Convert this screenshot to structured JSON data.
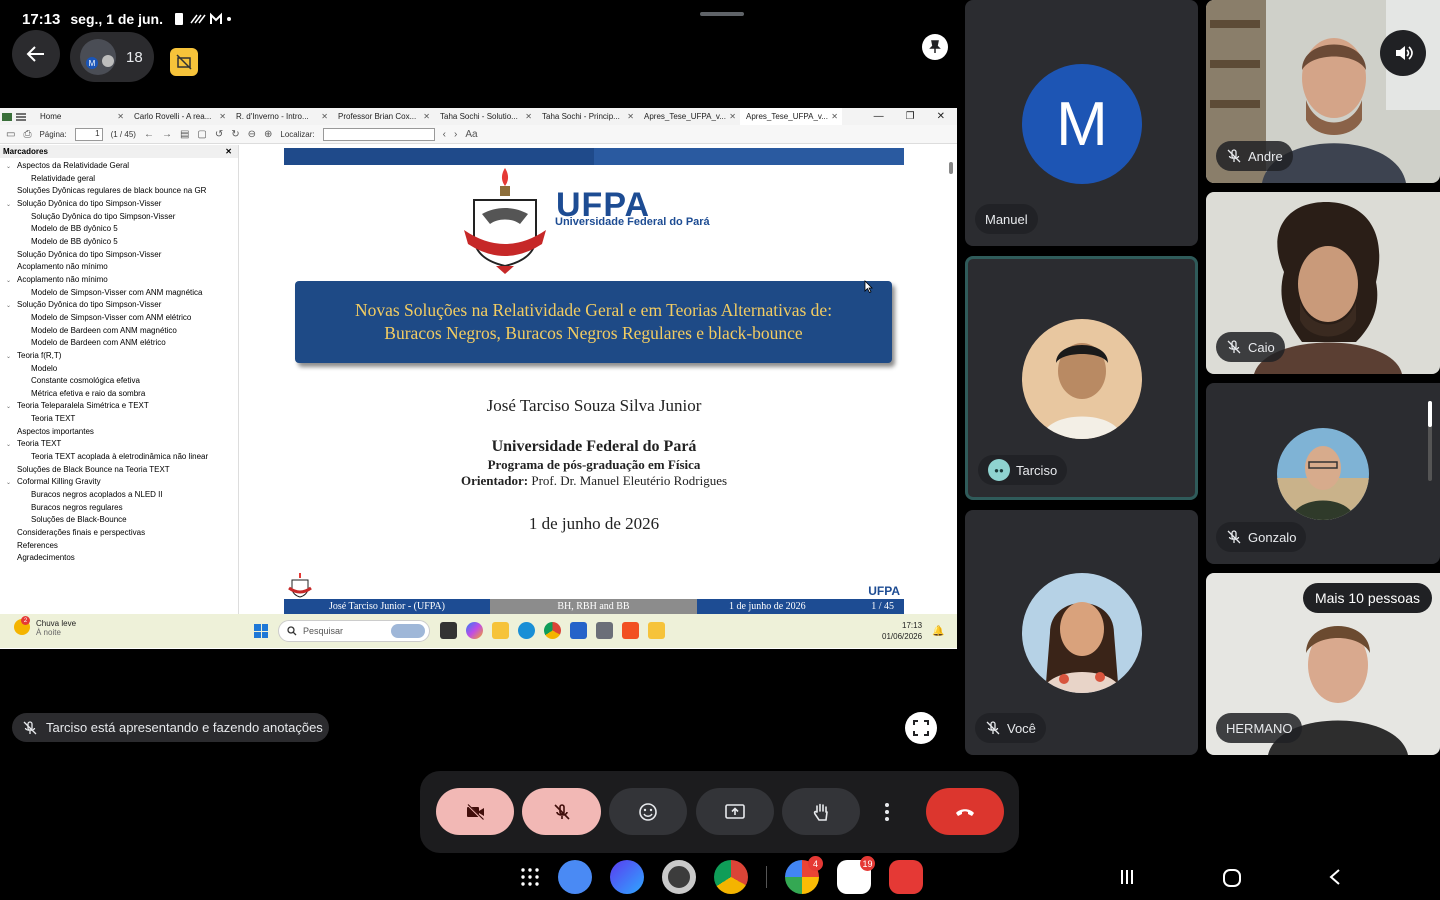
{
  "status_bar": {
    "time": "17:13",
    "date": "seg., 1 de jun."
  },
  "meeting": {
    "participant_count": "18"
  },
  "viewer": {
    "tabs": [
      "Home",
      "Carlo Rovelli - A rea...",
      "R. d'Inverno - Intro...",
      "Professor Brian Cox...",
      "Taha Sochi - Solutio...",
      "Taha Sochi - Princip...",
      "Apres_Tese_UFPA_v...",
      "Apres_Tese_UFPA_v..."
    ],
    "page_label": "Página:",
    "page_value": "1",
    "page_total": "(1 / 45)",
    "find_label": "Localizar:",
    "bookmarks_title": "Marcadores",
    "bookmarks": [
      {
        "label": "Aspectos da Relatividade Geral",
        "level": 0
      },
      {
        "label": "Relatividade geral",
        "level": 1
      },
      {
        "label": "Soluções Dyônicas regulares de black bounce na GR",
        "level": 0
      },
      {
        "label": "Solução Dyônica do tipo Simpson-Visser",
        "level": 0
      },
      {
        "label": "Solução Dyônica do tipo Simpson-Visser",
        "level": 1
      },
      {
        "label": "Modelo de BB dyônico 5",
        "level": 1
      },
      {
        "label": "Modelo de BB dyônico 5",
        "level": 1
      },
      {
        "label": "Solução Dyônica do tipo Simpson-Visser",
        "level": 0
      },
      {
        "label": "Acoplamento não mínimo",
        "level": 0
      },
      {
        "label": "Acoplamento não mínimo",
        "level": 0
      },
      {
        "label": "Modelo de Simpson-Visser com ANM magnética",
        "level": 1
      },
      {
        "label": "Solução Dyônica do tipo Simpson-Visser",
        "level": 0
      },
      {
        "label": "Modelo de Simpson-Visser com ANM elétrico",
        "level": 1
      },
      {
        "label": "Modelo de Bardeen com ANM magnético",
        "level": 1
      },
      {
        "label": "Modelo de Bardeen com ANM elétrico",
        "level": 1
      },
      {
        "label": "Teoria f(R,T)",
        "level": 0
      },
      {
        "label": "Modelo",
        "level": 1
      },
      {
        "label": "Constante cosmológica efetiva",
        "level": 1
      },
      {
        "label": "Métrica efetiva e raio da sombra",
        "level": 1
      },
      {
        "label": "Teoria Teleparalela Simétrica e TEXT",
        "level": 0
      },
      {
        "label": "Teoria TEXT",
        "level": 1
      },
      {
        "label": "Aspectos importantes",
        "level": 0
      },
      {
        "label": "Teoria TEXT",
        "level": 0
      },
      {
        "label": "Teoria TEXT acoplada à eletrodinâmica não linear",
        "level": 1
      },
      {
        "label": "Soluções de Black Bounce na Teoria TEXT",
        "level": 0
      },
      {
        "label": "Coformal Killing Gravity",
        "level": 0
      },
      {
        "label": "Buracos negros acoplados a NLED II",
        "level": 1
      },
      {
        "label": "Buracos negros regulares",
        "level": 1
      },
      {
        "label": "Soluções de Black-Bounce",
        "level": 1
      },
      {
        "label": "Considerações finais e perspectivas",
        "level": 0
      },
      {
        "label": "References",
        "level": 0
      },
      {
        "label": "Agradecimentos",
        "level": 0
      }
    ]
  },
  "slide": {
    "logo_text": "UFPA",
    "logo_subtitle": "Universidade Federal do Pará",
    "title_line1": "Novas Soluções na Relatividade Geral e em Teorias Alternativas de:",
    "title_line2": "Buracos Negros, Buracos Negros Regulares e black-bounce",
    "author": "José Tarciso Souza Silva Junior",
    "institution": "Universidade Federal do Pará",
    "program": "Programa de pós-graduação em Física",
    "advisor_label": "Orientador:",
    "advisor": "Prof. Dr. Manuel Eleutério Rodrigues",
    "date": "1 de junho de 2026",
    "footer_logo": "UFPA",
    "footer_left": "José Tarciso Junior -  (UFPA)",
    "footer_center": "BH, RBH and BB",
    "footer_date": "1 de junho de 2026",
    "footer_page": "1 / 45"
  },
  "windows_taskbar": {
    "weather_title": "Chuva leve",
    "weather_sub": "À noite",
    "weather_badge": "2",
    "search_placeholder": "Pesquisar",
    "time": "17:13",
    "date": "01/06/2026"
  },
  "presenter_notice": "Tarciso está apresentando e fazendo anotações",
  "participants": [
    {
      "name": "Manuel",
      "initial": "M"
    },
    {
      "name": "Tarciso"
    },
    {
      "name": "Você"
    },
    {
      "name": "Andre"
    },
    {
      "name": "Caio"
    },
    {
      "name": "Gonzalo"
    },
    {
      "name": "HERMANO"
    }
  ],
  "more_people": "Mais 10 pessoas",
  "dock_badges": {
    "photos": "4",
    "gmail": "19"
  },
  "colors": {
    "accent_blue": "#1d55b4",
    "hangup_red": "#dc362e",
    "muted_pink": "#f2b8b5",
    "ufpa_blue": "#1d4c93",
    "slide_title_gold": "#f2cc62"
  }
}
